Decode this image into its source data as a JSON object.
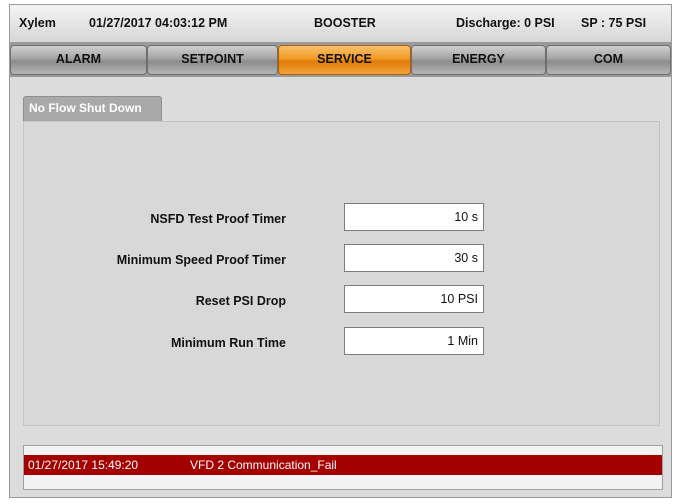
{
  "header": {
    "brand": "Xylem",
    "datetime": "01/27/2017 04:03:12 PM",
    "mode": "BOOSTER",
    "discharge": "Discharge: 0 PSI",
    "setpoint": "SP : 75 PSI"
  },
  "tabs": [
    {
      "label": "ALARM",
      "active": false
    },
    {
      "label": "SETPOINT",
      "active": false
    },
    {
      "label": "SERVICE",
      "active": true
    },
    {
      "label": "ENERGY",
      "active": false
    },
    {
      "label": "COM",
      "active": false
    }
  ],
  "subtab": {
    "label": "No Flow Shut Down"
  },
  "fields": [
    {
      "label": "NSFD Test Proof Timer",
      "value": "10 s"
    },
    {
      "label": "Minimum Speed Proof Timer",
      "value": "30 s"
    },
    {
      "label": "Reset PSI Drop",
      "value": "10 PSI"
    },
    {
      "label": "Minimum Run Time",
      "value": "1 Min"
    }
  ],
  "alarm": {
    "timestamp": "01/27/2017 15:49:20",
    "message": "VFD 2 Communication_Fail"
  },
  "colors": {
    "active_tab": "#f29a26",
    "alarm_bg": "#a40000"
  }
}
